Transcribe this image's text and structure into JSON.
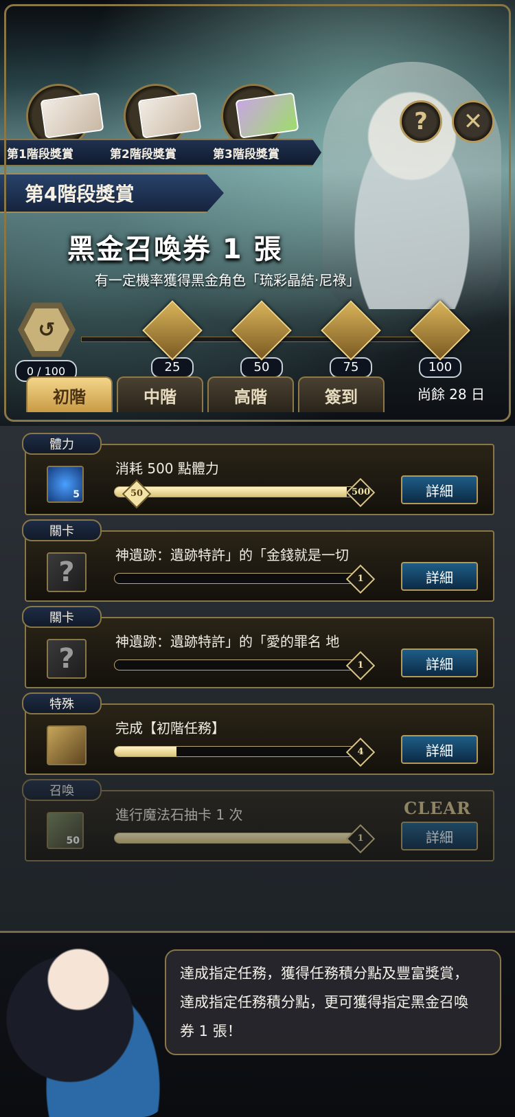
{
  "header": {
    "help_icon_label": "?",
    "close_icon_label": "✕",
    "stages": [
      "第1階段獎賞",
      "第2階段獎賞",
      "第3階段獎賞"
    ],
    "current_stage": "第4階段獎賞",
    "reward_title": "黑金召喚券 1 張",
    "reward_desc": "有一定機率獲得黑金角色「琉彩晶結‧尼祿」"
  },
  "progress": {
    "score": "0 / 100",
    "milestones": [
      "25",
      "50",
      "75",
      "100"
    ]
  },
  "tabs": [
    "初階",
    "中階",
    "高階",
    "簽到"
  ],
  "active_tab": 0,
  "days_left": "尚餘 28 日",
  "tasks": [
    {
      "tag": "體力",
      "text": "消耗 500 點體力",
      "start": "50",
      "end": "500",
      "progress": 0.94,
      "button": "詳細",
      "icon_text": "5"
    },
    {
      "tag": "關卡",
      "text": "神遺跡：遺跡特許」的「金錢就是一切",
      "end": "1",
      "progress": 0,
      "button": "詳細",
      "icon_text": "?"
    },
    {
      "tag": "關卡",
      "text": "神遺跡：遺跡特許」的「愛的罪名 地",
      "end": "1",
      "progress": 0,
      "button": "詳細",
      "icon_text": "?"
    },
    {
      "tag": "特殊",
      "text": "完成【初階任務】",
      "end": "4",
      "progress": 0.25,
      "button": "詳細"
    },
    {
      "tag": "召喚",
      "text": "進行魔法石抽卡 1 次",
      "end": "1",
      "progress": 1,
      "button": "詳細",
      "status": "CLEAR",
      "icon_text": "50"
    }
  ],
  "footer": {
    "text": "達成指定任務，獲得任務積分點及豐富獎賞，達成指定任務積分點，更可獲得指定黑金召喚券 1 張！"
  }
}
